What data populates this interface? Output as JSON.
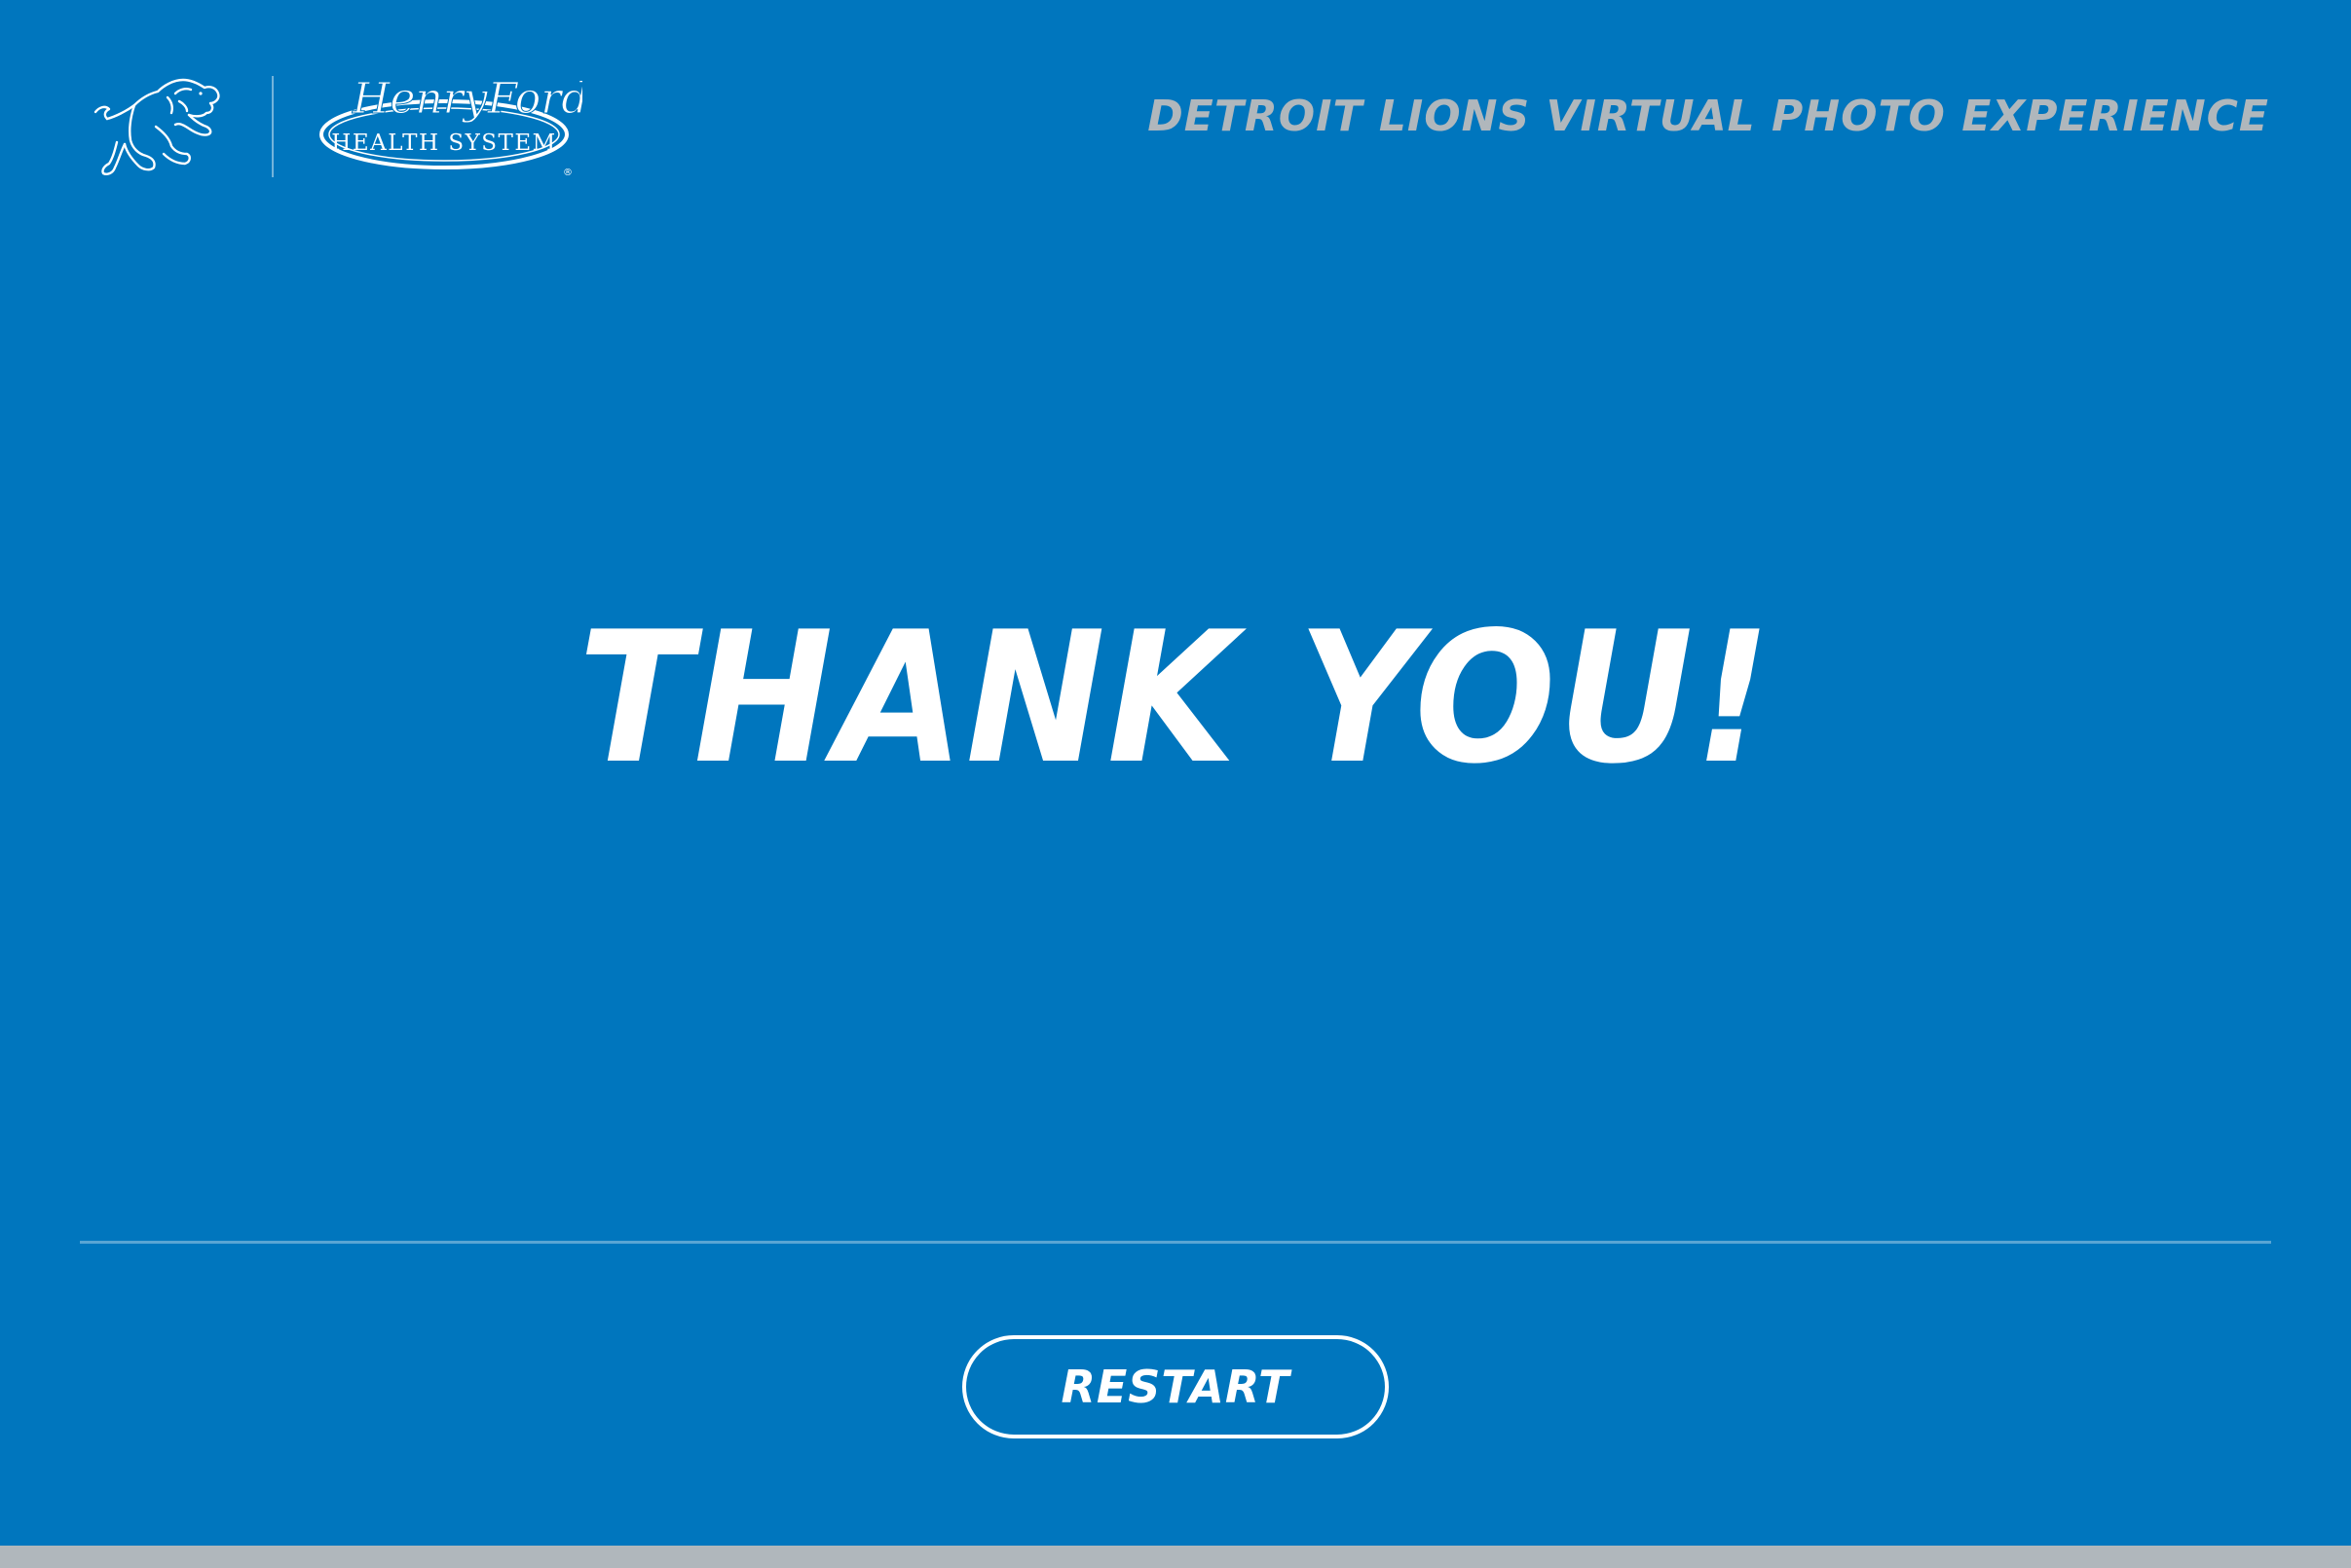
{
  "header": {
    "title": "DETROIT LIONS VIRTUAL PHOTO EXPERIENCE",
    "logos": {
      "team_logo_icon": "lion-logo-icon",
      "sponsor_logo_text_1": "HenryFord",
      "sponsor_logo_text_2": "HEALTH SYSTEM",
      "sponsor_logo_mark": "®"
    }
  },
  "main": {
    "heading": "THANK YOU!"
  },
  "actions": {
    "restart_label": "RESTART"
  },
  "colors": {
    "background": "#0076BE",
    "header_title": "#B0B7BC",
    "text": "#FFFFFF",
    "footer_bar": "#B0B7BC"
  }
}
